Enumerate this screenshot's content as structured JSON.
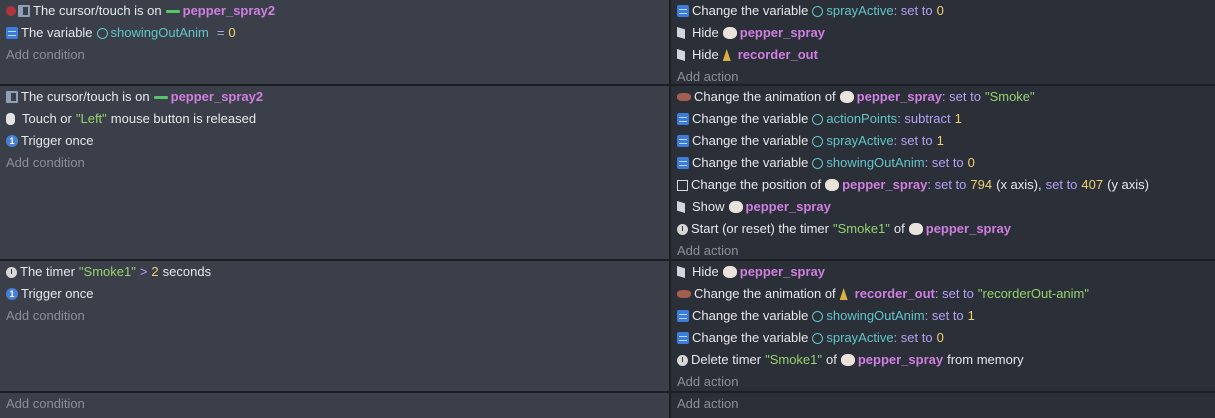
{
  "common": {
    "add_condition": "Add condition",
    "add_action": "Add action"
  },
  "icons": {
    "variable": "variable-icon",
    "cursor": "cursor-icon",
    "object_group": "object-line-icon",
    "globe": "globe-icon",
    "mouse": "mouse-icon",
    "trigger": "trigger-once-icon",
    "timer": "timer-icon",
    "visibility": "visibility-flag-icon",
    "sprite": "sprite-icon",
    "recorder": "recorder-icon",
    "animation": "animation-icon",
    "position": "position-icon"
  },
  "colors": {
    "object": "#d07fe0",
    "variable": "#61c6c9",
    "operator": "#b3a1f5",
    "number": "#f2cf73",
    "string": "#96d36f"
  },
  "event1": {
    "c1": {
      "text": "The cursor/touch is on",
      "obj": "pepper_spray2"
    },
    "c2": {
      "pre": "The variable",
      "var": "showingOutAnim",
      "op": "=",
      "num": "0"
    },
    "a1": {
      "pre": "Change the variable",
      "var": "sprayActive",
      "op": ": set to",
      "num": "0"
    },
    "a2": {
      "pre": "Hide",
      "obj": "pepper_spray"
    },
    "a3": {
      "pre": "Hide",
      "obj": "recorder_out"
    }
  },
  "event2": {
    "c1": {
      "text": "The cursor/touch is on",
      "obj": "pepper_spray2"
    },
    "c2": {
      "pre": "Touch or",
      "str": "\"Left\"",
      "post": "mouse button is released"
    },
    "c3": {
      "text": "Trigger once"
    },
    "a1": {
      "pre": "Change the animation of",
      "obj": "pepper_spray",
      "op": ": set to",
      "str": "\"Smoke\""
    },
    "a2": {
      "pre": "Change the variable",
      "var": "actionPoints",
      "op": ": subtract",
      "num": "1"
    },
    "a3": {
      "pre": "Change the variable",
      "var": "sprayActive",
      "op": ": set to",
      "num": "1"
    },
    "a4": {
      "pre": "Change the variable",
      "var": "showingOutAnim",
      "op": ": set to",
      "num": "0"
    },
    "a5": {
      "pre": "Change the position of",
      "obj": "pepper_spray",
      "op1": ": set to",
      "num1": "794",
      "mid": "(x axis),",
      "op2": "set to",
      "num2": "407",
      "post": "(y axis)"
    },
    "a6": {
      "pre": "Show",
      "obj": "pepper_spray"
    },
    "a7": {
      "pre": "Start (or reset) the timer",
      "str": "\"Smoke1\"",
      "mid": "of",
      "obj": "pepper_spray"
    }
  },
  "event3": {
    "c1": {
      "pre": "The timer",
      "str": "\"Smoke1\"",
      "op": ">",
      "num": "2",
      "post": "seconds"
    },
    "c2": {
      "text": "Trigger once"
    },
    "a1": {
      "pre": "Hide",
      "obj": "pepper_spray"
    },
    "a2": {
      "pre": "Change the animation of",
      "obj": "recorder_out",
      "op": ": set to",
      "str": "\"recorderOut-anim\""
    },
    "a3": {
      "pre": "Change the variable",
      "var": "showingOutAnim",
      "op": ": set to",
      "num": "1"
    },
    "a4": {
      "pre": "Change the variable",
      "var": "sprayActive",
      "op": ": set to",
      "num": "0"
    },
    "a5": {
      "pre": "Delete timer",
      "str": "\"Smoke1\"",
      "mid": "of",
      "obj": "pepper_spray",
      "post": "from memory"
    }
  }
}
